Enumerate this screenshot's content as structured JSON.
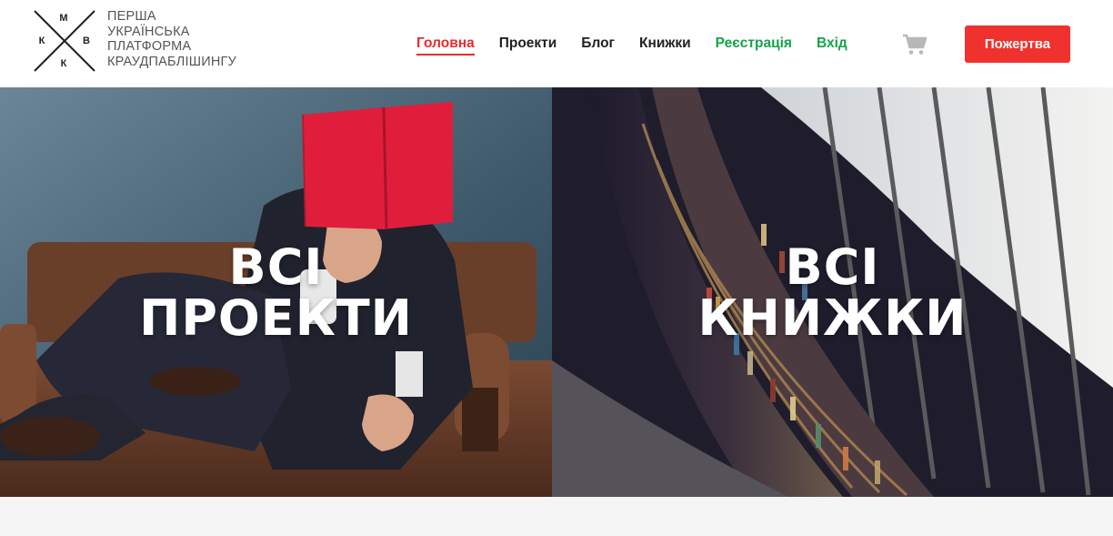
{
  "logo": {
    "letters": {
      "top": "М",
      "left": "К",
      "right": "В",
      "bottom": "К"
    },
    "lines": [
      "ПЕРША",
      "УКРАЇНСЬКА",
      "ПЛАТФОРМА",
      "КРАУДПАБЛІШИНГУ"
    ]
  },
  "nav": {
    "items": [
      {
        "label": "Головна",
        "state": "active"
      },
      {
        "label": "Проекти"
      },
      {
        "label": "Блог"
      },
      {
        "label": "Книжки"
      },
      {
        "label": "Реєстрація"
      },
      {
        "label": "Вхід"
      }
    ]
  },
  "cart": {
    "icon": "shopping-cart-icon"
  },
  "donate": {
    "label": "Пожертва"
  },
  "hero": {
    "left": {
      "line1": "ВСІ",
      "line2": "ПРОЕКТИ"
    },
    "right": {
      "line1": "ВСІ",
      "line2": "КНИЖКИ"
    }
  },
  "colors": {
    "accent_red": "#f0322e",
    "active_nav": "#e82c2c",
    "green_links": "#16a34a",
    "text_dark": "#222222"
  }
}
